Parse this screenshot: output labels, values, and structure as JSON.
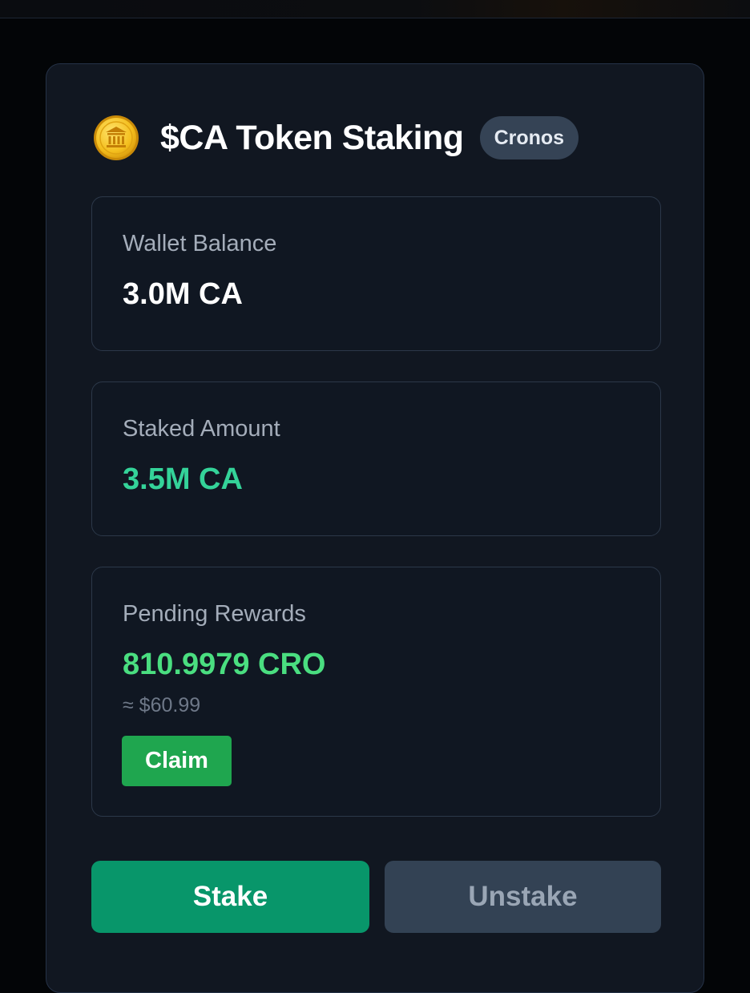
{
  "header": {
    "title": "$CA Token Staking",
    "network_badge": "Cronos",
    "icon": "coin-bank-icon"
  },
  "wallet_balance": {
    "label": "Wallet Balance",
    "value": "3.0M CA"
  },
  "staked_amount": {
    "label": "Staked Amount",
    "value": "3.5M CA"
  },
  "pending_rewards": {
    "label": "Pending Rewards",
    "value": "810.9979 CRO",
    "usd_value": "≈ $60.99",
    "claim_label": "Claim"
  },
  "actions": {
    "stake_label": "Stake",
    "unstake_label": "Unstake"
  },
  "colors": {
    "background": "#030507",
    "card": "#111721",
    "staked_value": "#34d399",
    "rewards_value": "#4ade80",
    "claim_button": "#1fa64f",
    "stake_button": "#08966a",
    "unstake_button": "#334254"
  }
}
